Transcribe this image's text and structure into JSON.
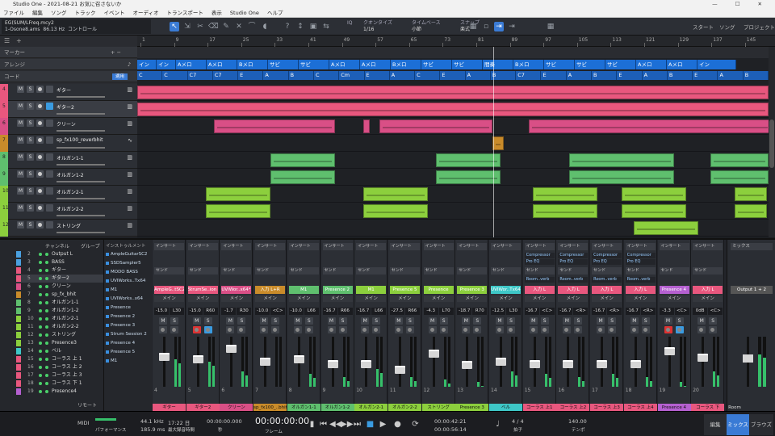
{
  "app": {
    "title": "Studio One - 2021-08-21 お気に召さないか",
    "window_buttons": "— ☐ ✕"
  },
  "menu": [
    "ファイル",
    "編集",
    "ソング",
    "トラック",
    "イベント",
    "オーディオ",
    "トランスポート",
    "表示",
    "Studio One",
    "ヘルプ"
  ],
  "toolbar": {
    "song_path": "EG(SUM/LFreq.mcy2",
    "song_sub": "1-Osone8.ams",
    "freq": "86.13 Hz",
    "control_label": "コントロール",
    "quantize_label": "クオンタイズ",
    "quantize_value": "1/16",
    "timebase_label": "タイムベース",
    "timebase_value": "小節",
    "snap_label": "スナップ",
    "snap_value": "楽式",
    "iq": "IQ",
    "start": "スタート",
    "song": "ソング",
    "project": "プロジェクト"
  },
  "leftpanel": {
    "marker_label": "マーカー",
    "arrange_label": "アレンジ",
    "chord_label": "コード",
    "chord_button": "適用"
  },
  "tracks": [
    {
      "num": "4",
      "name": "ギター",
      "color": "#e8577e",
      "inst": "▥"
    },
    {
      "num": "5",
      "name": "ギター2",
      "color": "#e8577e",
      "inst": "▥"
    },
    {
      "num": "6",
      "name": "クリーン",
      "color": "#d94f86",
      "inst": "▥"
    },
    {
      "num": "7",
      "name": "sp_fx100_reverbhit",
      "color": "#c98b2a",
      "inst": "∿"
    },
    {
      "num": "8",
      "name": "オルガン1-1",
      "color": "#5fbf6e",
      "inst": "▥"
    },
    {
      "num": "9",
      "name": "オルガン1-2",
      "color": "#5fbf6e",
      "inst": "▥"
    },
    {
      "num": "10",
      "name": "オルガン2-1",
      "color": "#8ccf3d",
      "inst": "▥"
    },
    {
      "num": "11",
      "name": "オルガン2-2",
      "color": "#8ccf3d",
      "inst": "▥"
    },
    {
      "num": "12",
      "name": "ストリング",
      "color": "#8ccf3d",
      "inst": "▥"
    }
  ],
  "ruler": [
    "1",
    "9",
    "17",
    "25",
    "33",
    "41",
    "49",
    "57",
    "65",
    "73",
    "81",
    "89",
    "97",
    "105",
    "113",
    "121",
    "129",
    "137",
    "145"
  ],
  "sections": [
    {
      "label": "イン",
      "w": 24
    },
    {
      "label": "イン",
      "w": 24
    },
    {
      "label": "Aメロ",
      "w": 38
    },
    {
      "label": "Aメロ",
      "w": 38
    },
    {
      "label": "Bメロ",
      "w": 38
    },
    {
      "label": "サビ",
      "w": 38
    },
    {
      "label": "サビ",
      "w": 38
    },
    {
      "label": "Aメロ",
      "w": 38
    },
    {
      "label": "Aメロ",
      "w": 38
    },
    {
      "label": "Bメロ",
      "w": 38
    },
    {
      "label": "サビ",
      "w": 38
    },
    {
      "label": "サビ",
      "w": 38
    },
    {
      "label": "間奏",
      "w": 38
    },
    {
      "label": "Bメロ",
      "w": 38
    },
    {
      "label": "サビ",
      "w": 38
    },
    {
      "label": "サビ",
      "w": 38
    },
    {
      "label": "サビ",
      "w": 38
    },
    {
      "label": "Aメロ",
      "w": 38
    },
    {
      "label": "Aメロ",
      "w": 38
    },
    {
      "label": "イン",
      "w": 48
    }
  ],
  "chords": [
    "C",
    "C",
    "C7",
    "C7",
    "E",
    "A",
    "B",
    "C",
    "Cm",
    "E",
    "A",
    "C",
    "E",
    "A",
    "B",
    "C7",
    "E",
    "A",
    "B",
    "E",
    "A",
    "B",
    "E",
    "A",
    "B"
  ],
  "channels": [
    {
      "n": "2",
      "name": "Output L",
      "sw": "#4aa0e0"
    },
    {
      "n": "3",
      "name": "BASS",
      "sw": "#4aa0e0"
    },
    {
      "n": "4",
      "name": "ギター",
      "sw": "#e8577e"
    },
    {
      "n": "5",
      "name": "ギター2",
      "sw": "#e8577e"
    },
    {
      "n": "6",
      "name": "クリーン",
      "sw": "#d94f86"
    },
    {
      "n": "7",
      "name": "sp_fx_bhit",
      "sw": "#c98b2a"
    },
    {
      "n": "8",
      "name": "オルガン1-1",
      "sw": "#5fbf6e"
    },
    {
      "n": "9",
      "name": "オルガン1-2",
      "sw": "#5fbf6e"
    },
    {
      "n": "10",
      "name": "オルガン2-1",
      "sw": "#8ccf3d"
    },
    {
      "n": "11",
      "name": "オルガン2-2",
      "sw": "#8ccf3d"
    },
    {
      "n": "12",
      "name": "ストリング",
      "sw": "#8ccf3d"
    },
    {
      "n": "13",
      "name": "Presence3",
      "sw": "#8ccf3d"
    },
    {
      "n": "14",
      "name": "ベル",
      "sw": "#3ec7c7"
    },
    {
      "n": "15",
      "name": "コーラス 上 1",
      "sw": "#e8577e"
    },
    {
      "n": "16",
      "name": "コーラス 上 2",
      "sw": "#e8577e"
    },
    {
      "n": "17",
      "name": "コーラス 上 3",
      "sw": "#e8577e"
    },
    {
      "n": "18",
      "name": "コーラス 下 1",
      "sw": "#e8577e"
    },
    {
      "n": "19",
      "name": "Presence4",
      "sw": "#b560d0"
    }
  ],
  "instruments": [
    "AmpleGuitarSC2",
    "SSDSampler5",
    "MODO BASS",
    "UVIWorks..Tx64",
    "M1",
    "UVIWorks..x64",
    "Presence",
    "Presence 2",
    "Presence 3",
    "Strum Session 2",
    "Presence 4",
    "Presence 5",
    "M1"
  ],
  "console_labels": {
    "channel": "チャンネル",
    "group": "グループ",
    "instrument": "インストゥルメント",
    "insert": "インサート",
    "send": "センド",
    "input": "入力",
    "main": "メイン",
    "remote": "リモート",
    "room": "Room",
    "output": "Output 1 + 2",
    "mixer": "ミックス"
  },
  "strips": [
    {
      "name": "AmpleG..tSC2",
      "vol": "-15.0",
      "pan": "L30",
      "color": "#e8577e",
      "foot": "ギター",
      "idx": "4",
      "fader": 0.62,
      "level": 0.55,
      "rec": false
    },
    {
      "name": "StrumSe..ion 2",
      "vol": "-15.0",
      "pan": "R60",
      "color": "#e8577e",
      "foot": "ギター2",
      "idx": "5",
      "fader": 0.55,
      "level": 0.5,
      "rec": true
    },
    {
      "name": "UVIWor..x64*2",
      "vol": "-1.7",
      "pan": "R30",
      "color": "#d94f86",
      "foot": "クリーン",
      "idx": "6",
      "fader": 0.8,
      "level": 0.3,
      "rec": false
    },
    {
      "name": "入力 L+R",
      "vol": "-10.0",
      "pan": "<C>",
      "color": "#c98b2a",
      "foot": "sp_fx100_..bhit",
      "idx": "7",
      "fader": 0.5,
      "level": 0.0,
      "rec": false
    },
    {
      "name": "M1",
      "vol": "-10.0",
      "pan": "L66",
      "color": "#5fbf6e",
      "foot": "オルガン1-1",
      "idx": "8",
      "fader": 0.55,
      "level": 0.25,
      "rec": false
    },
    {
      "name": "Presence 2",
      "vol": "-16.7",
      "pan": "R66",
      "color": "#5fbf6e",
      "foot": "オルガン1-2",
      "idx": "9",
      "fader": 0.45,
      "level": 0.2,
      "rec": false
    },
    {
      "name": "M1",
      "vol": "-16.7",
      "pan": "L66",
      "color": "#8ccf3d",
      "foot": "オルガン2-1",
      "idx": "10",
      "fader": 0.45,
      "level": 0.35,
      "rec": false
    },
    {
      "name": "Presence 5",
      "vol": "-27.5",
      "pan": "R66",
      "color": "#8ccf3d",
      "foot": "オルガン2-2",
      "idx": "11",
      "fader": 0.3,
      "level": 0.2,
      "rec": false
    },
    {
      "name": "Presence",
      "vol": "-4.3",
      "pan": "L70",
      "color": "#8ccf3d",
      "foot": "ストリング",
      "idx": "12",
      "fader": 0.7,
      "level": 0.15,
      "rec": false
    },
    {
      "name": "Presence 3",
      "vol": "-18.7",
      "pan": "R70",
      "color": "#8ccf3d",
      "foot": "Presence 3",
      "idx": "13",
      "fader": 0.42,
      "level": 0.1,
      "rec": false
    },
    {
      "name": "UVIWor..Tx64",
      "vol": "-12.5",
      "pan": "L30",
      "color": "#3ec7c7",
      "foot": "ベル",
      "idx": "14",
      "fader": 0.5,
      "level": 0.3,
      "rec": false
    },
    {
      "name": "入力 L",
      "vol": "-16.7",
      "pan": "<C>",
      "color": "#e8577e",
      "foot": "コーラス 上1",
      "idx": "15",
      "fader": 0.45,
      "level": 0.25,
      "rec": false
    },
    {
      "name": "入力 L",
      "vol": "-16.7",
      "pan": "<R>",
      "color": "#e8577e",
      "foot": "コーラス 上2",
      "idx": "16",
      "fader": 0.45,
      "level": 0.2,
      "rec": false
    },
    {
      "name": "入力 L",
      "vol": "-16.7",
      "pan": "<R>",
      "color": "#e8577e",
      "foot": "コーラス 上3",
      "idx": "17",
      "fader": 0.45,
      "level": 0.25,
      "rec": false
    },
    {
      "name": "入力 L",
      "vol": "-16.7",
      "pan": "<R>",
      "color": "#e8577e",
      "foot": "コーラス 上4",
      "idx": "18",
      "fader": 0.45,
      "level": 0.2,
      "rec": false
    },
    {
      "name": "Presence 4",
      "vol": "-3.3",
      "pan": "<C>",
      "color": "#b560d0",
      "foot": "Presence 4",
      "idx": "19",
      "fader": 0.75,
      "level": 0.1,
      "rec": true
    },
    {
      "name": "入力 L",
      "vol": "0dB",
      "pan": "<C>",
      "color": "#e8577e",
      "foot": "コーラス 下",
      "idx": "20",
      "fader": 0.6,
      "level": 0.3,
      "rec": false
    }
  ],
  "transport": {
    "midi": "MIDI",
    "performance": "パフォーマンス",
    "sample_rate": "44.1 kHz",
    "latency": "185.9 ms",
    "date": "17:22 日",
    "rec_max": "最大録音時間",
    "time_main": "00:00:00.000",
    "time_main_label": "秒",
    "time_big": "00:00:00:00",
    "time_big_label": "フレーム",
    "loop_start": "00:00:42:21",
    "loop_end": "00:00:56:14",
    "signature": "4 / 4",
    "signature_label": "拍子",
    "tempo": "140.00",
    "tempo_label": "テンポ",
    "tab_edit": "編集",
    "tab_mix": "ミックス",
    "tab_browse": "ブラウズ"
  }
}
